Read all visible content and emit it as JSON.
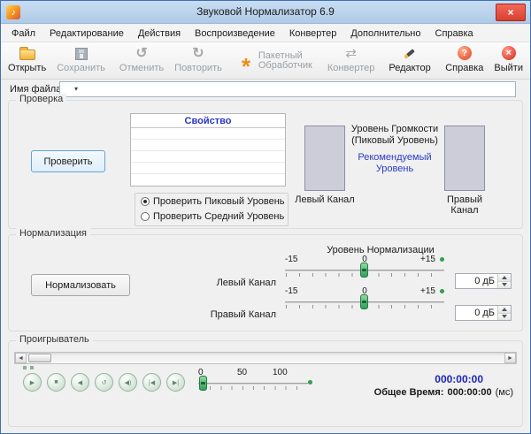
{
  "window": {
    "title": "Звуковой Нормализатор 6.9",
    "app_icon_glyph": "♪",
    "close_glyph": "×"
  },
  "menu": {
    "items": [
      "Файл",
      "Редактирование",
      "Действия",
      "Воспроизведение",
      "Конвертер",
      "Дополнительно",
      "Справка"
    ]
  },
  "toolbar": {
    "buttons": [
      {
        "name": "open",
        "label": "Открыть",
        "glyph": "",
        "disabled": false
      },
      {
        "name": "save",
        "label": "Сохранить",
        "glyph": "",
        "disabled": true
      },
      {
        "name": "undo",
        "label": "Отменить",
        "glyph": "↺",
        "disabled": true
      },
      {
        "name": "redo",
        "label": "Повторить",
        "glyph": "↻",
        "disabled": true
      },
      {
        "name": "batch",
        "label": "Пакетный Обработчик",
        "glyph": "*",
        "disabled": true
      },
      {
        "name": "converter",
        "label": "Конвертер",
        "glyph": "⇄",
        "disabled": true
      },
      {
        "name": "editor",
        "label": "Редактор",
        "glyph": "",
        "disabled": false
      },
      {
        "name": "help",
        "label": "Справка",
        "glyph": "?",
        "disabled": false
      },
      {
        "name": "exit",
        "label": "Выйти",
        "glyph": "×",
        "disabled": false
      }
    ]
  },
  "file": {
    "label": "Имя файла:",
    "value": "",
    "chevron": "▾"
  },
  "check": {
    "title": "Проверка",
    "button": "Проверить",
    "table": {
      "header": "Свойство",
      "rows": [
        "",
        "",
        "",
        "",
        ""
      ]
    },
    "radios": [
      {
        "label": "Проверить Пиковый Уровень",
        "selected": true
      },
      {
        "label": "Проверить Средний Уровень",
        "selected": false
      }
    ],
    "volume_heading": "Уровень Громкости (Пиковый Уровень)",
    "recommended_link": "Рекомендуемый Уровень",
    "left_meter_label": "Левый Канал",
    "right_meter_label": "Правый Канал"
  },
  "normalize": {
    "title": "Нормализация",
    "button": "Нормализовать",
    "heading": "Уровень Нормализации",
    "scale": {
      "min": "-15",
      "mid": "0",
      "max": "+15"
    },
    "channels": [
      {
        "label": "Левый Канал",
        "value": "0 дБ",
        "slider_position": 0
      },
      {
        "label": "Правый Канал",
        "value": "0 дБ",
        "slider_position": 0
      }
    ]
  },
  "player": {
    "title": "Проигрыватель",
    "seek_back_glyph": "◄",
    "seek_forward_glyph": "►",
    "buttons": [
      {
        "name": "play",
        "glyph": "▶"
      },
      {
        "name": "stop",
        "glyph": "■"
      },
      {
        "name": "rewind",
        "glyph": "◀"
      },
      {
        "name": "repeat",
        "glyph": "↺"
      },
      {
        "name": "volume",
        "glyph": "◀)"
      },
      {
        "name": "previous",
        "glyph": "|◀"
      },
      {
        "name": "next",
        "glyph": "▶|"
      }
    ],
    "volume_scale": {
      "min": "0",
      "mid": "50",
      "max": "100"
    },
    "current_time": "000:00:00",
    "total_time_label": "Общее Время:",
    "total_time_value": "000:00:00",
    "total_time_unit": "(мс)"
  },
  "colors": {
    "window_border": "#3d6fb4",
    "close_red": "#d9402f",
    "link_blue": "#2b3cc4",
    "time_blue": "#1f24b8",
    "table_header_blue": "#2a35c0",
    "slider_handle_green": "#2f9e57",
    "meter_fill": "#cdcdda"
  }
}
